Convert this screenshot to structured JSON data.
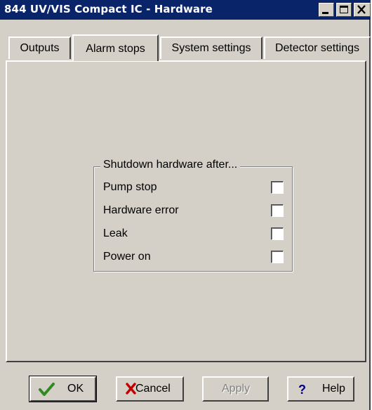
{
  "window": {
    "title": "844 UV/VIS Compact IC - Hardware"
  },
  "title_buttons": [
    "minimize-icon",
    "maximize-icon",
    "close-icon"
  ],
  "tabs": [
    {
      "label": "Outputs",
      "active": false
    },
    {
      "label": "Alarm stops",
      "active": true
    },
    {
      "label": "System settings",
      "active": false
    },
    {
      "label": "Detector settings",
      "active": false
    }
  ],
  "group": {
    "title": "Shutdown hardware after...",
    "options": [
      {
        "label": "Pump stop",
        "checked": false
      },
      {
        "label": "Hardware error",
        "checked": false
      },
      {
        "label": "Leak",
        "checked": false
      },
      {
        "label": "Power on",
        "checked": false
      }
    ]
  },
  "buttons": {
    "ok": {
      "label": "OK",
      "icon": "checkmark-icon",
      "icon_color": "#2f8a1f"
    },
    "cancel": {
      "label": "Cancel",
      "icon": "red-x-icon",
      "icon_color": "#c00000"
    },
    "apply": {
      "label": "Apply",
      "disabled": true
    },
    "help": {
      "label": "Help",
      "icon": "question-mark-icon",
      "icon_color": "#000080"
    }
  }
}
